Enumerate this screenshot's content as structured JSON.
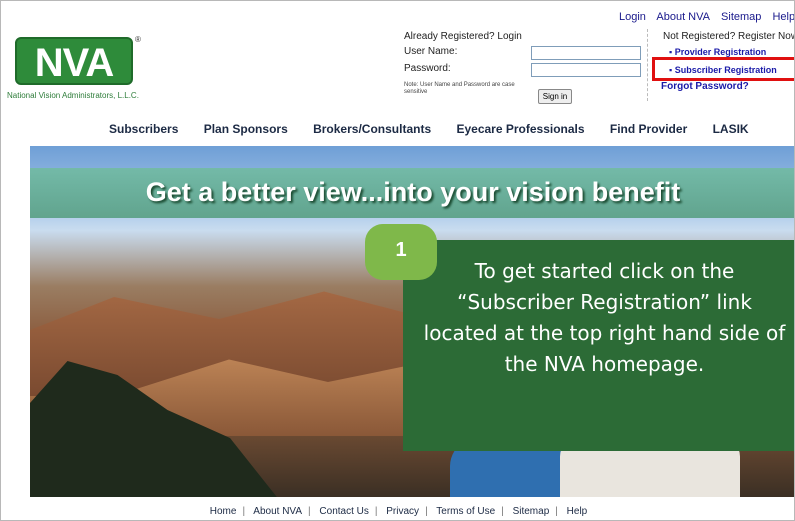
{
  "toplinks": [
    "Login",
    "About NVA",
    "Sitemap",
    "Help"
  ],
  "logo": {
    "text": "NVA",
    "tm": "®",
    "caption": "National Vision Administrators, L.L.C."
  },
  "login": {
    "title": "Already Registered? Login",
    "username_label": "User Name:",
    "password_label": "Password:",
    "note": "Note: User Name and Password are case sensitive",
    "signin_label": "Sign in"
  },
  "register": {
    "title": "Not Registered? Register Now",
    "provider": "Provider Registration",
    "subscriber": "Subscriber Registration",
    "forgot": "Forgot Password?"
  },
  "nav": [
    "Subscribers",
    "Plan Sponsors",
    "Brokers/Consultants",
    "Eyecare Professionals",
    "Find Provider",
    "LASIK"
  ],
  "hero": {
    "banner": "Get a better view...into your vision benefit"
  },
  "callout": {
    "step": "1",
    "text": "To get started click on the “Subscriber Registration” link located at the top right hand side of the NVA homepage."
  },
  "footer": [
    "Home",
    "About NVA",
    "Contact Us",
    "Privacy",
    "Terms of Use",
    "Sitemap",
    "Help"
  ],
  "colors": {
    "brand_green": "#2e8b3a",
    "callout_green": "#2c6b36",
    "step_green": "#7fb84a",
    "highlight_red": "#e01010",
    "link_blue": "#1a1aa8"
  }
}
